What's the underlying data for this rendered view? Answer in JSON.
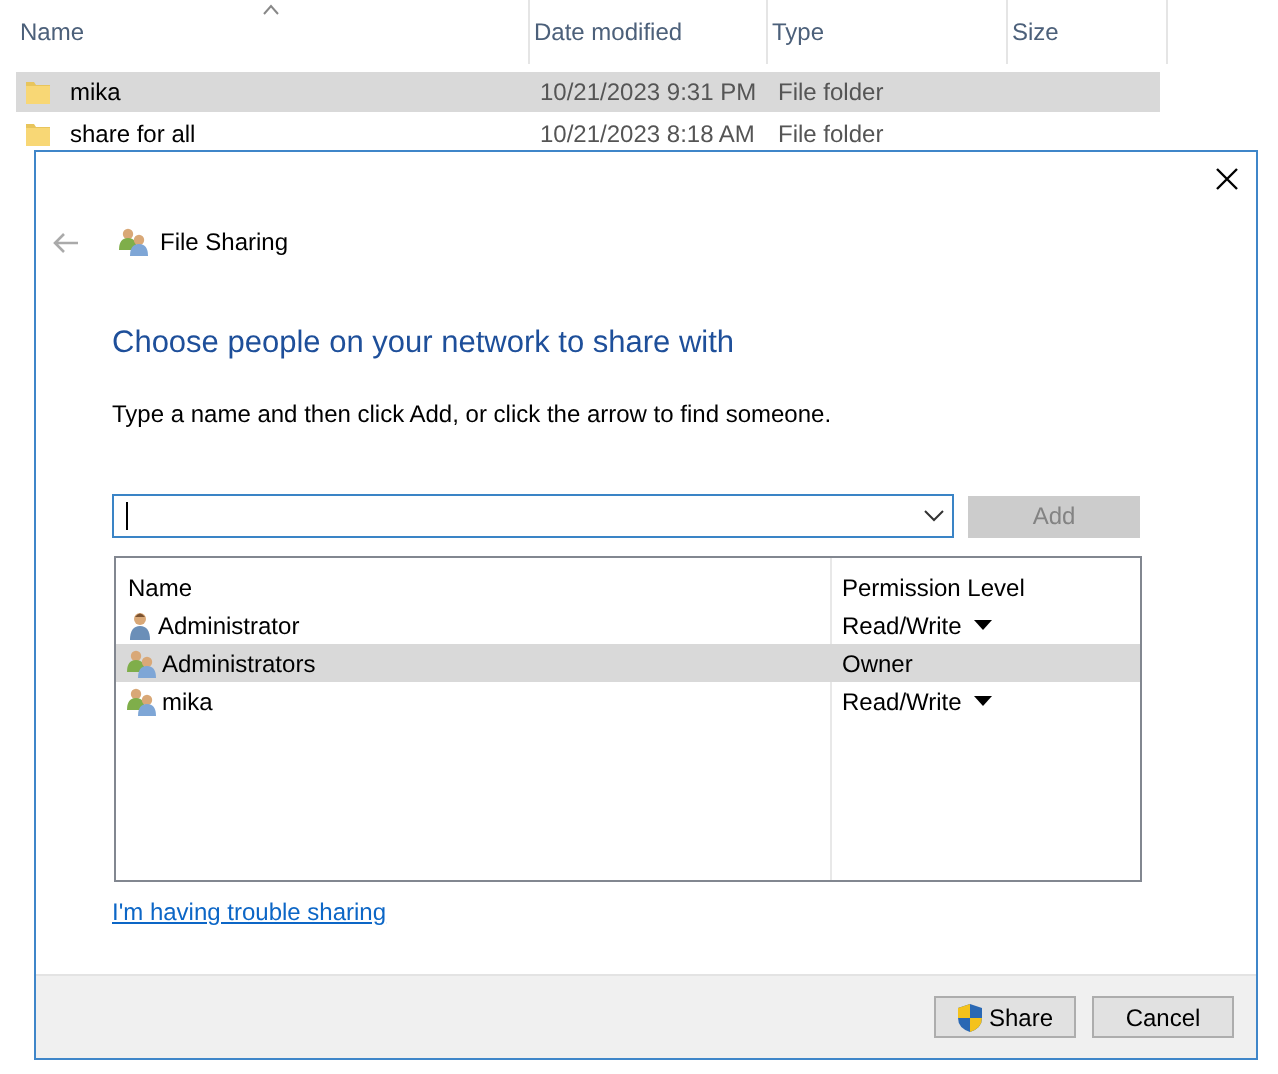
{
  "explorer": {
    "columns": [
      "Name",
      "Date modified",
      "Type",
      "Size"
    ],
    "rows": [
      {
        "name": "mika",
        "date": "10/21/2023 9:31 PM",
        "type": "File folder",
        "selected": true
      },
      {
        "name": "share for all",
        "date": "10/21/2023 8:18 AM",
        "type": "File folder",
        "selected": false
      }
    ]
  },
  "dialog": {
    "title": "File Sharing",
    "heading": "Choose people on your network to share with",
    "instruction": "Type a name and then click Add, or click the arrow to find someone.",
    "add_button": {
      "label": "Add",
      "disabled": true
    },
    "list": {
      "columns": [
        "Name",
        "Permission Level"
      ],
      "rows": [
        {
          "name": "Administrator",
          "kind": "user",
          "permission": "Read/Write",
          "has_menu": true,
          "selected": false
        },
        {
          "name": "Administrators",
          "kind": "group",
          "permission": "Owner",
          "has_menu": false,
          "selected": true
        },
        {
          "name": "mika",
          "kind": "group",
          "permission": "Read/Write",
          "has_menu": true,
          "selected": false
        }
      ]
    },
    "link": "I'm having trouble sharing",
    "buttons": [
      {
        "label": "Share",
        "kind": "shield"
      },
      {
        "label": "Cancel",
        "kind": "plain"
      }
    ]
  }
}
